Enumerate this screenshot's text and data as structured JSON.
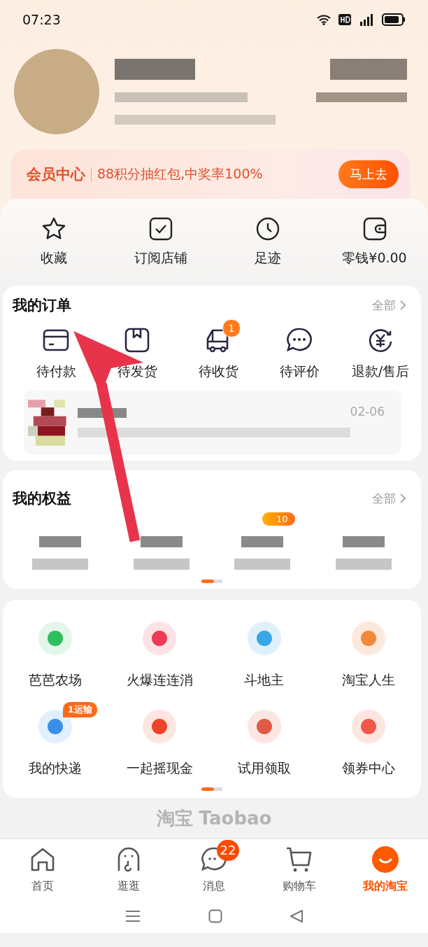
{
  "status_bar": {
    "time": "07:23"
  },
  "member_banner": {
    "title": "会员中心",
    "text": "88积分抽红包,中奖率100%",
    "button": "马上去"
  },
  "shortcuts": [
    {
      "label": "收藏"
    },
    {
      "label": "订阅店铺"
    },
    {
      "label": "足迹"
    },
    {
      "label": "零钱¥0.00"
    }
  ],
  "orders": {
    "title": "我的订单",
    "all_link": "全部",
    "items": [
      {
        "label": "待付款"
      },
      {
        "label": "待发货"
      },
      {
        "label": "待收货",
        "badge": "1"
      },
      {
        "label": "待评价"
      },
      {
        "label": "退款/售后"
      }
    ],
    "recent": {
      "date": "02-06"
    }
  },
  "rights": {
    "title": "我的权益",
    "all_link": "全部",
    "badge": "10",
    "pages": [
      {
        "selected": true
      },
      {
        "selected": false
      }
    ]
  },
  "services": {
    "items": [
      {
        "label": "芭芭农场"
      },
      {
        "label": "火爆连连消"
      },
      {
        "label": "斗地主"
      },
      {
        "label": "淘宝人生"
      },
      {
        "label": "我的快递",
        "badge": "1运输"
      },
      {
        "label": "一起摇现金"
      },
      {
        "label": "试用领取"
      },
      {
        "label": "领券中心"
      }
    ],
    "pages": [
      {
        "selected": true
      },
      {
        "selected": false
      }
    ]
  },
  "footer_logo": "淘宝 Taobao",
  "tabs": [
    {
      "label": "首页",
      "selected": false
    },
    {
      "label": "逛逛",
      "selected": false
    },
    {
      "label": "消息",
      "selected": false,
      "badge": "22"
    },
    {
      "label": "购物车",
      "selected": false
    },
    {
      "label": "我的淘宝",
      "selected": true
    }
  ]
}
